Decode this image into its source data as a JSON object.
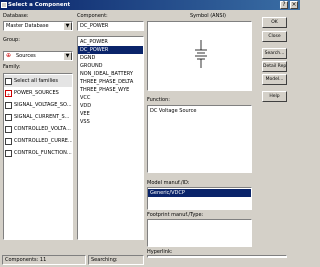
{
  "window": {
    "title": "Select a Component"
  },
  "database": {
    "label": "Database:",
    "value": "Master Database"
  },
  "group": {
    "label": "Group:",
    "value": "Sources"
  },
  "family": {
    "label": "Family:",
    "items": [
      "Select all families",
      "POWER_SOURCES",
      "SIGNAL_VOLTAGE_SO...",
      "SIGNAL_CURRENT_S...",
      "CONTROLLED_VOLTA...",
      "CONTROLLED_CURRE...",
      "CONTROL_FUNCTION..."
    ]
  },
  "component": {
    "label": "Component:",
    "search_value": "DC_POWER",
    "items": [
      "AC_POWER",
      "DC_POWER",
      "DGND",
      "GROUND",
      "NON_IDEAL_BATTERY",
      "THREE_PHASE_DELTA",
      "THREE_PHASE_WYE",
      "VCC",
      "VDD",
      "VEE",
      "VSS"
    ],
    "selected_index": 1
  },
  "symbol": {
    "label": "Symbol (ANSI)"
  },
  "function": {
    "label": "Function:",
    "value": "DC Voltage Source"
  },
  "model": {
    "label": "Model manuf./ID:",
    "items": [
      "Generic/VDCP"
    ]
  },
  "footprint": {
    "label": "Footprint manuf./Type:"
  },
  "hyperlink": {
    "label": "Hyperlink:"
  },
  "buttons": {
    "ok": "OK",
    "close": "Close",
    "search": "Search...",
    "detail_report": "Detail Report",
    "model": "Model...",
    "help": "Help"
  },
  "status": {
    "components": "Components: 11",
    "searching": "Searching:"
  }
}
